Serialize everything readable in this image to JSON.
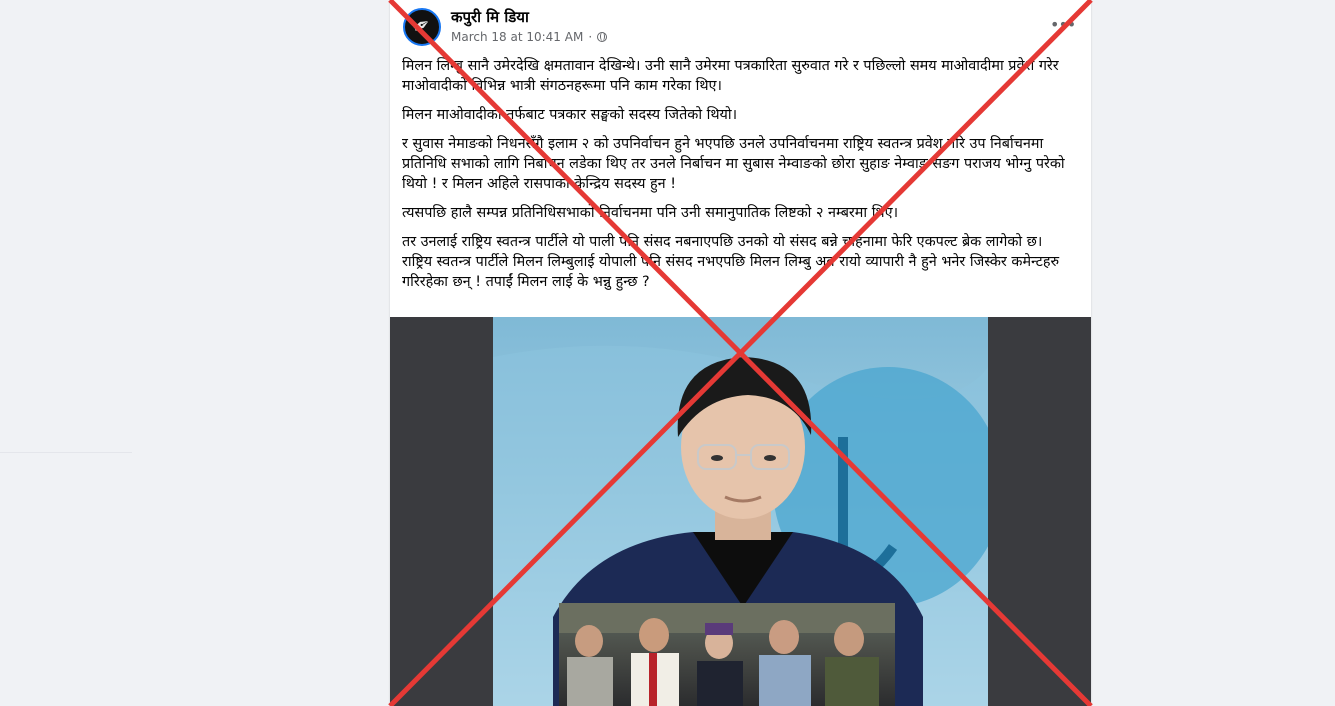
{
  "post": {
    "page_name": "कपुरी मि डिया",
    "timestamp": "March 18 at 10:41 AM",
    "separator": "·",
    "paragraphs": [
      "मिलन लिम्बु सानै उमेरदेखि क्षमतावान देखिन्थे। उनी सानै उमेरमा पत्रकारिता सुरुवात गरे र पछिल्लो समय माओवादीमा प्रवेश गरेर माओवादीको विभिन्न भात्री संगठनहरूमा पनि काम गरेका थिए।",
      "मिलन माओवादीको तर्फबाट पत्रकार सङ्घको सदस्य जितेको थियो।",
      "र सुवास नेमाङको निधनसँगै इलाम २ को उपनिर्वाचन हुने भएपछि उनले उपनिर्वाचनमा राष्ट्रिय स्वतन्त्र प्रवेश गरि उप निर्बाचनमा प्रतिनिधि सभाको लागि निर्बाचन लडेका थिए तर उनले निर्बाचन मा  सुबास नेम्वाङको छोरा सुहाङ नेम्वाङ सङग पराजय भोग्नु परेको थियो ! र मिलन अहिले रासपाको केन्द्रिय सदस्य हुन !",
      "त्यसपछि हालै सम्पन्न प्रतिनिधिसभाको निर्वाचनमा पनि उनी समानुपातिक लिष्टको २ नम्बरमा थिए।",
      "तर उनलाई राष्ट्रिय स्वतन्त्र पार्टीले यो पाली पनि संसद नबनाएपछि उनको यो संसद बन्ने चाहनामा फेरि एकपल्ट ब्रेक लागेको छ।",
      "राष्ट्रिय स्वतन्त्र पार्टीले मिलन लिम्बुलाई योपाली पनि संसद नभएपछि मिलन लिम्बु अब रायो व्यापारी नै हुने भनेर जिस्केर कमेन्टहरु गरिरहेका छन् ! तपाईं मिलन लाई के भन्नु हुन्छ ?"
    ],
    "more_icon": "•••"
  },
  "icons": {
    "avatar": "avatar-logo",
    "privacy": "globe-icon",
    "more": "more-options-icon",
    "overlay": "red-x-mark"
  },
  "colors": {
    "overlay_red": "#e53935",
    "link_blue": "#1877f2",
    "secondary_text": "#65676b"
  }
}
